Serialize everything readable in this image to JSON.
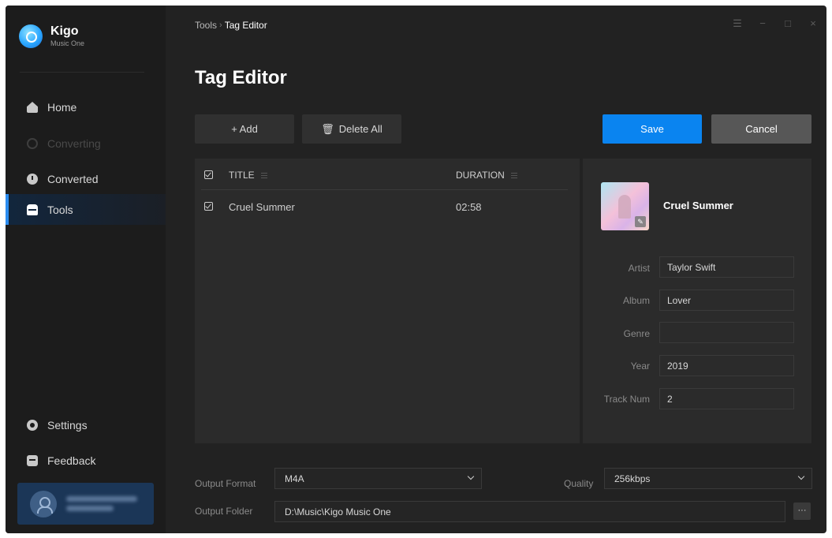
{
  "app": {
    "name": "Kigo",
    "subtitle": "Music One"
  },
  "sidebar": {
    "items": [
      {
        "label": "Home",
        "icon": "home-icon"
      },
      {
        "label": "Converting",
        "icon": "converting-icon",
        "disabled": true
      },
      {
        "label": "Converted",
        "icon": "converted-icon"
      },
      {
        "label": "Tools",
        "icon": "tools-icon",
        "active": true
      }
    ],
    "bottom_items": [
      {
        "label": "Settings",
        "icon": "settings-icon"
      },
      {
        "label": "Feedback",
        "icon": "feedback-icon"
      }
    ]
  },
  "breadcrumb": {
    "root": "Tools",
    "separator": "›",
    "current": "Tag Editor"
  },
  "page": {
    "title": "Tag Editor"
  },
  "toolbar": {
    "add_label": "+ Add",
    "delete_all_label": "Delete All",
    "save_label": "Save",
    "cancel_label": "Cancel"
  },
  "table": {
    "columns": [
      "TITLE",
      "DURATION"
    ],
    "rows": [
      {
        "title": "Cruel Summer",
        "duration": "02:58",
        "checked": true
      }
    ]
  },
  "detail": {
    "song_title": "Cruel Summer",
    "fields": {
      "artist": {
        "label": "Artist",
        "value": "Taylor Swift"
      },
      "album": {
        "label": "Album",
        "value": "Lover"
      },
      "genre": {
        "label": "Genre",
        "value": ""
      },
      "year": {
        "label": "Year",
        "value": "2019"
      },
      "track_num": {
        "label": "Track Num",
        "value": "2"
      }
    }
  },
  "output": {
    "format_label": "Output Format",
    "format_value": "M4A",
    "quality_label": "Quality",
    "quality_value": "256kbps",
    "folder_label": "Output Folder",
    "folder_value": "D:\\Music\\Kigo Music One",
    "browse_label": "···"
  },
  "window_controls": {
    "menu": "☰",
    "minimize": "−",
    "maximize": "□",
    "close": "×"
  },
  "colors": {
    "accent": "#0a84f0",
    "background": "#222222",
    "sidebar": "#1c1c1c",
    "panel": "#2b2b2b",
    "active_nav": "#12263d"
  }
}
